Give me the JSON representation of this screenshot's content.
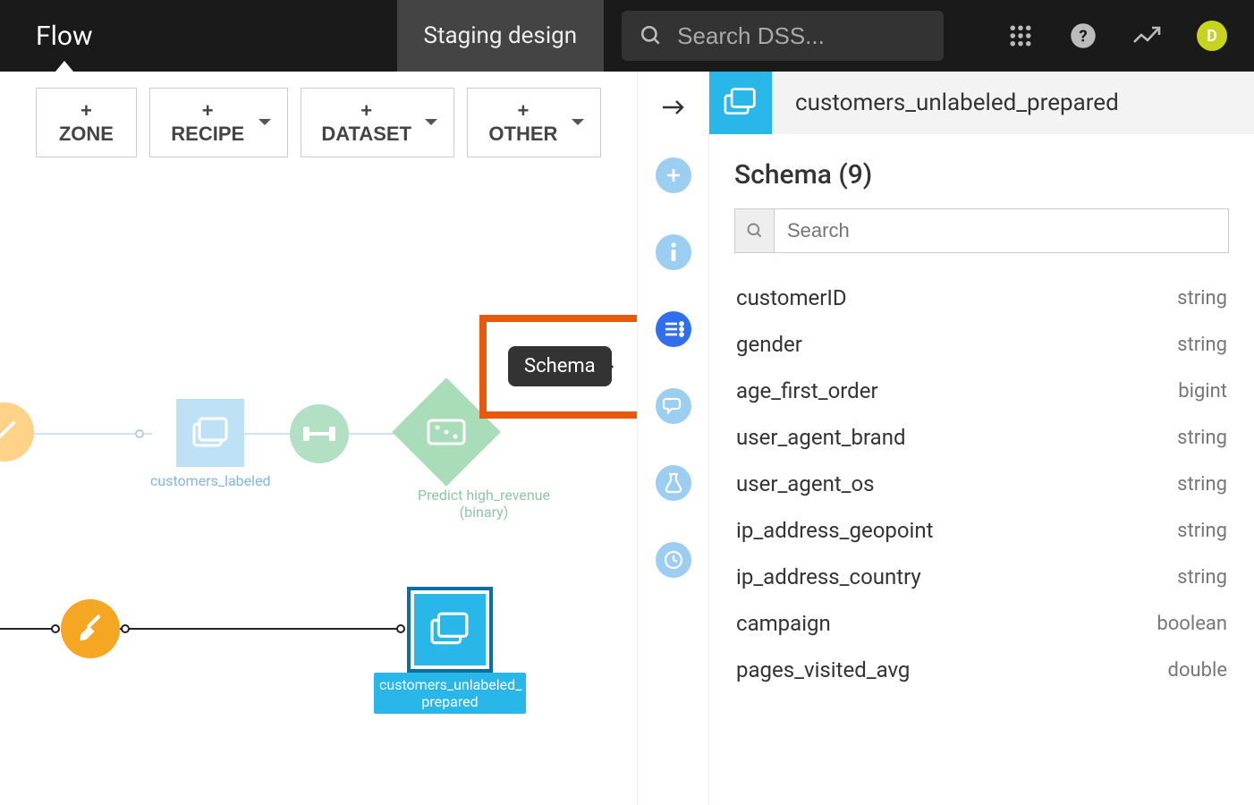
{
  "topbar": {
    "title": "Flow",
    "tab": "Staging design",
    "search_placeholder": "Search DSS...",
    "avatar_initial": "D"
  },
  "toolbar": {
    "zone": "+ ZONE",
    "recipe": "+ RECIPE",
    "dataset": "+ DATASET",
    "other": "+ OTHER"
  },
  "rail": {
    "tooltip": "Schema"
  },
  "right_panel": {
    "title": "customers_unlabeled_prepared",
    "section": "Schema (9)",
    "search_placeholder": "Search",
    "columns": [
      {
        "name": "customerID",
        "type": "string"
      },
      {
        "name": "gender",
        "type": "string"
      },
      {
        "name": "age_first_order",
        "type": "bigint"
      },
      {
        "name": "user_agent_brand",
        "type": "string"
      },
      {
        "name": "user_agent_os",
        "type": "string"
      },
      {
        "name": "ip_address_geopoint",
        "type": "string"
      },
      {
        "name": "ip_address_country",
        "type": "string"
      },
      {
        "name": "campaign",
        "type": "boolean"
      },
      {
        "name": "pages_visited_avg",
        "type": "double"
      }
    ]
  },
  "flow_nodes": {
    "customers_labeled": "customers_labeled",
    "predict": "Predict high_revenue (binary)",
    "customers_unlabeled_prepared": "customers_unlabeled_\nprepared"
  }
}
